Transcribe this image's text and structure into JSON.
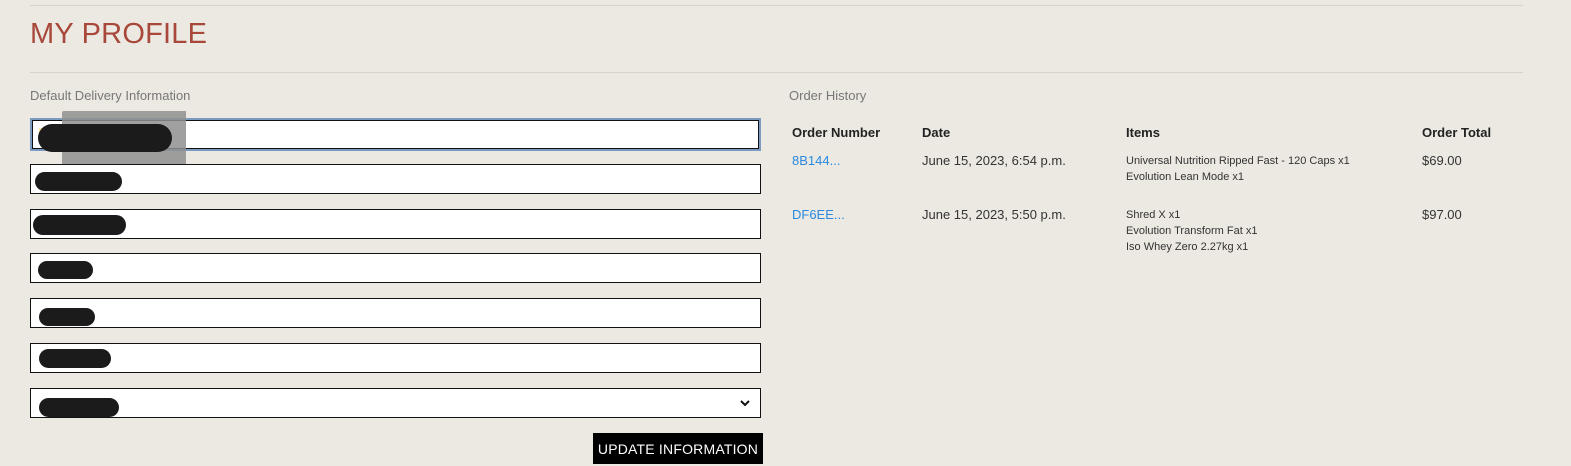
{
  "page": {
    "title": "MY PROFILE"
  },
  "delivery": {
    "section_label": "Default Delivery Information",
    "update_button_label": "UPDATE INFORMATION"
  },
  "history": {
    "section_label": "Order History",
    "columns": [
      "Order Number",
      "Date",
      "Items",
      "Order Total"
    ],
    "orders": [
      {
        "number": "8B144...",
        "date": "June 15, 2023, 6:54 p.m.",
        "items": [
          "Universal Nutrition Ripped Fast - 120 Caps x1",
          "Evolution Lean Mode x1"
        ],
        "total": "$69.00"
      },
      {
        "number": "DF6EE...",
        "date": "June 15, 2023, 5:50 p.m.",
        "items": [
          "Shred X x1",
          "Evolution Transform Fat x1",
          "Iso Whey Zero 2.27kg x1"
        ],
        "total": "$97.00"
      }
    ]
  },
  "colors": {
    "background": "#ece9e2",
    "title": "#a8483a",
    "link": "#2a8ae0",
    "button": "#000000"
  },
  "icons": {
    "select": "chevron-down-icon"
  }
}
